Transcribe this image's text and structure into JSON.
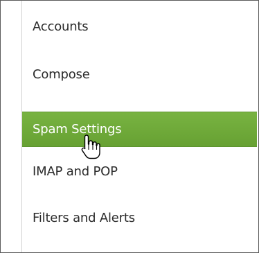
{
  "menu": {
    "items": [
      {
        "label": "Accounts",
        "selected": false
      },
      {
        "label": "Compose",
        "selected": false
      },
      {
        "label": "Spam Settings",
        "selected": true
      },
      {
        "label": "IMAP and POP",
        "selected": false
      },
      {
        "label": "Filters and Alerts",
        "selected": false
      }
    ]
  },
  "cursor": {
    "icon": "hand-pointer-icon"
  },
  "colors": {
    "selected_background": "#6fa93a",
    "selected_text": "#ffffff",
    "text": "#2b2b2b"
  }
}
